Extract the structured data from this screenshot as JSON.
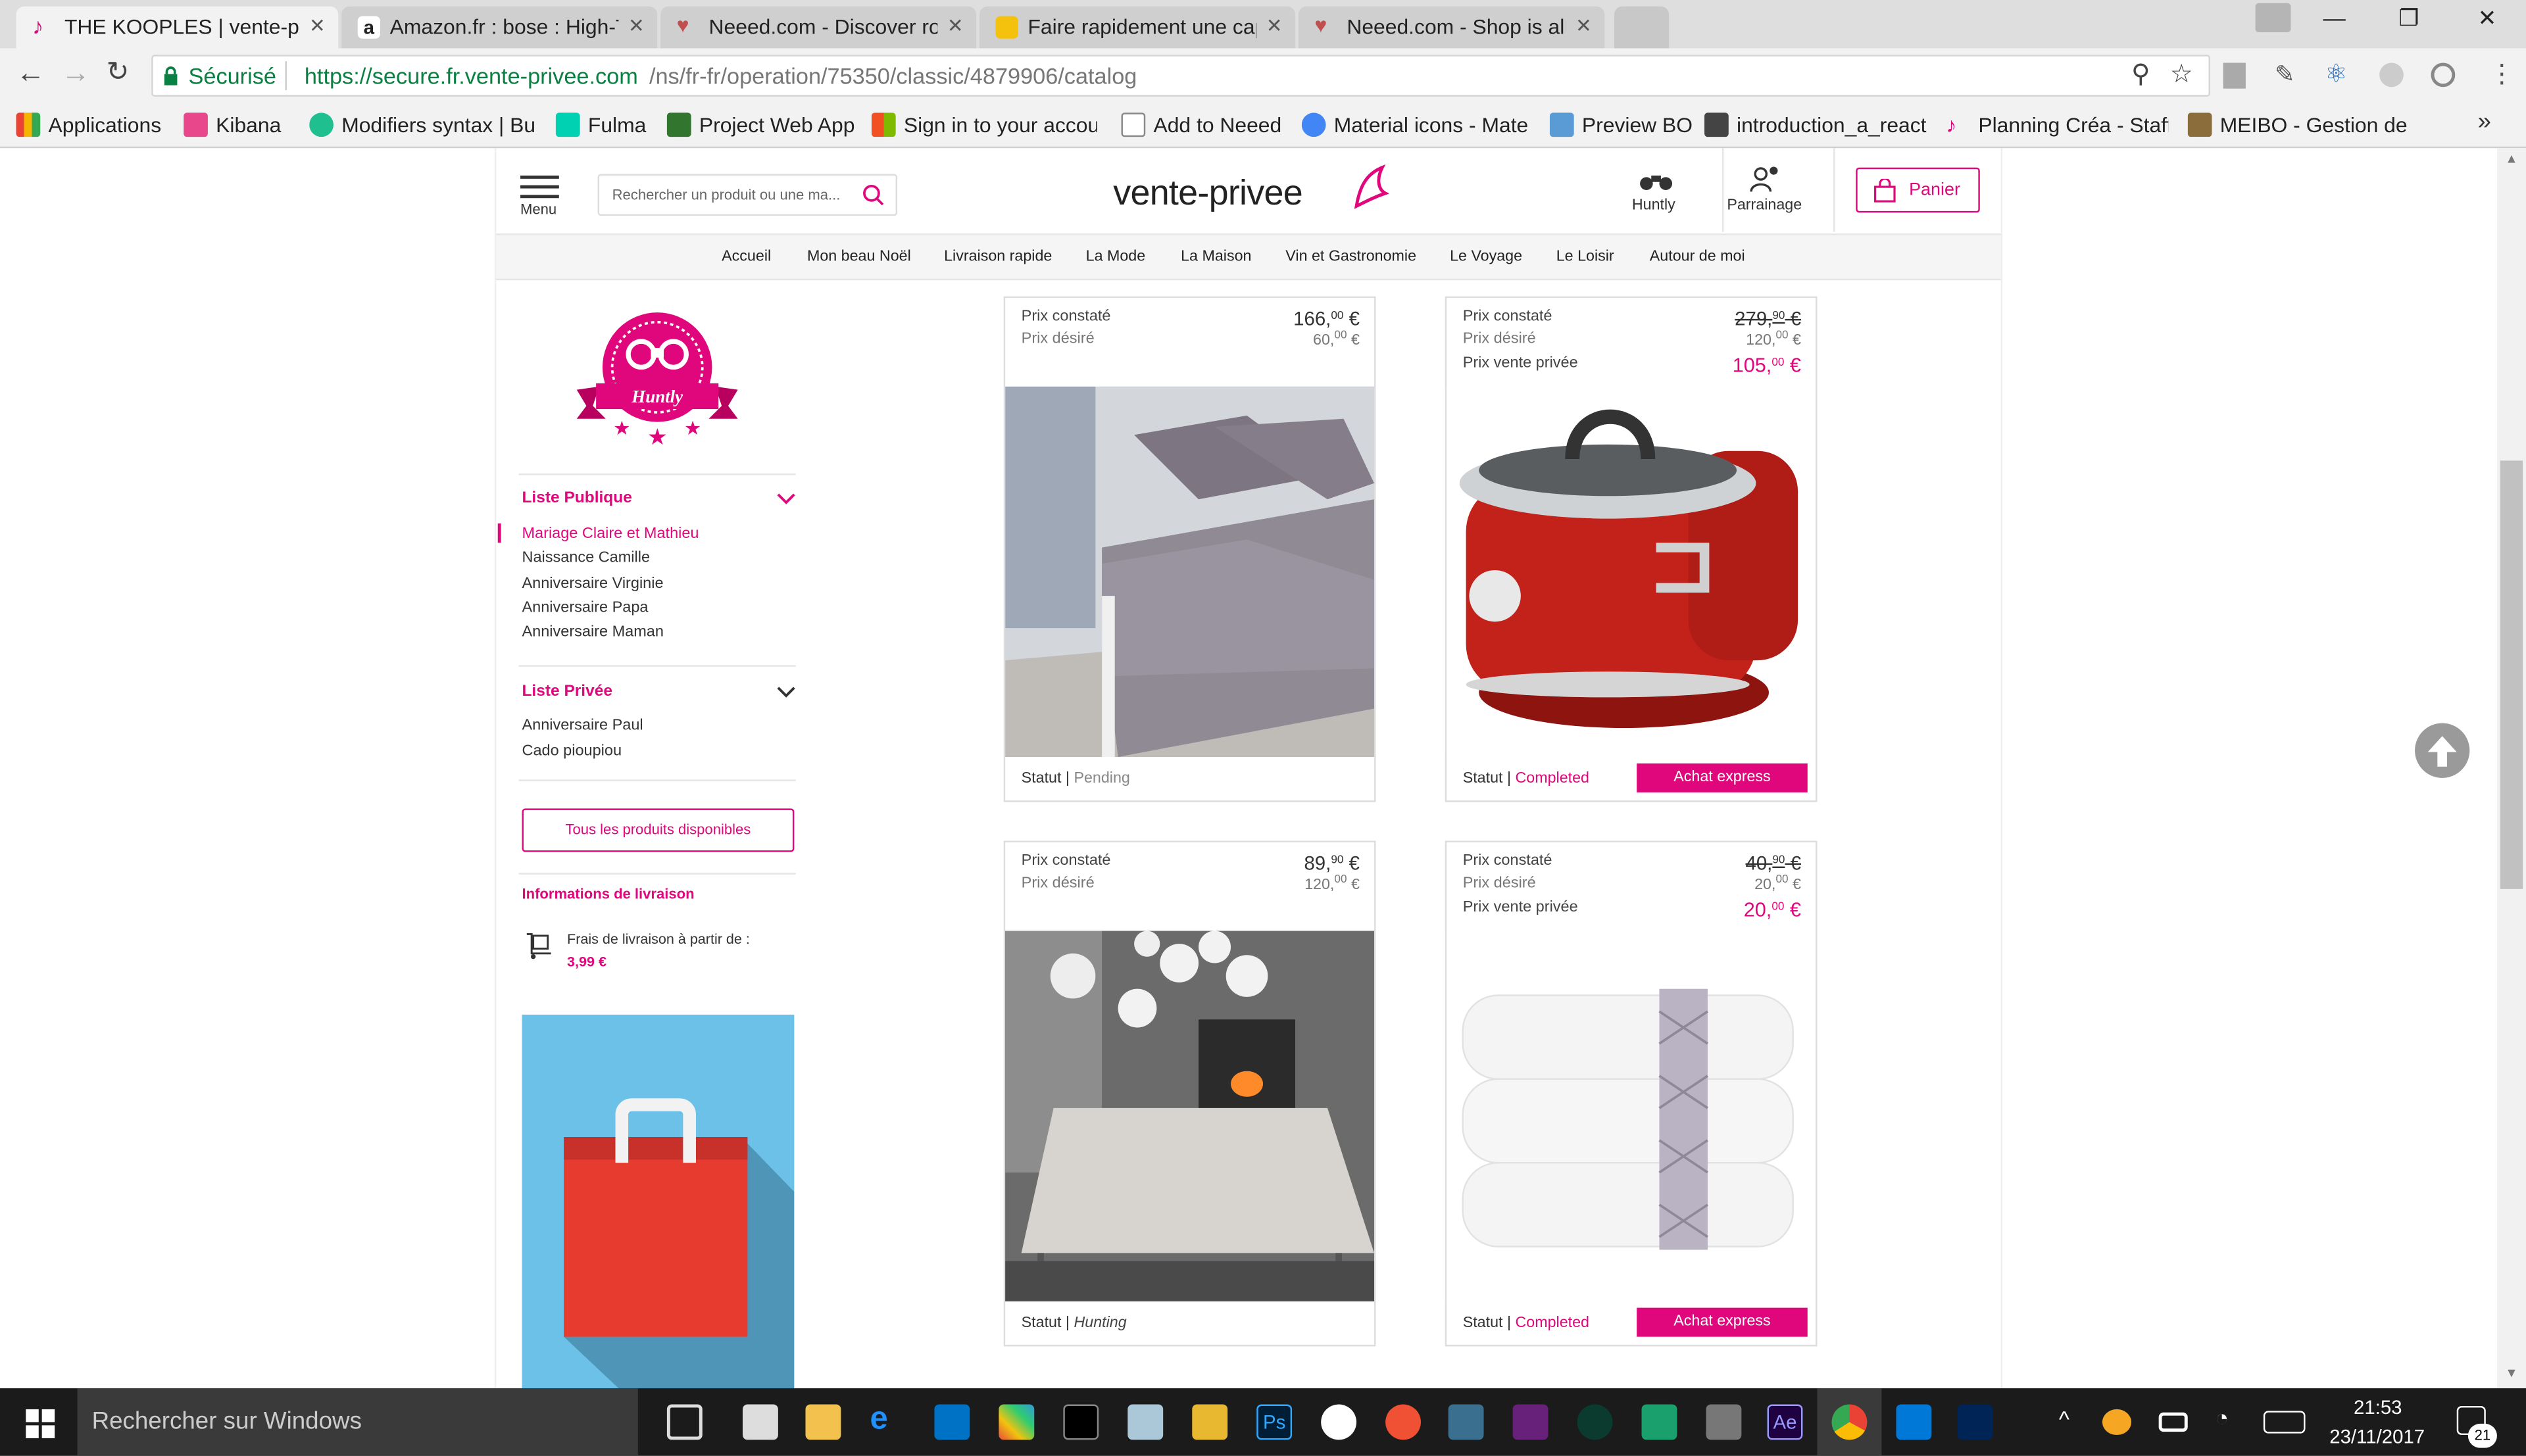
{
  "browser": {
    "tabs": [
      {
        "title": "THE KOOPLES | vente-pri",
        "color": "#e0077d"
      },
      {
        "title": "Amazon.fr : bose : High-T",
        "color": "#222222"
      },
      {
        "title": "Neeed.com - Discover ro",
        "color": "#c0504d"
      },
      {
        "title": "Faire rapidement une cap",
        "color": "#f4c20d"
      },
      {
        "title": "Neeed.com - Shop is all",
        "color": "#c0504d"
      }
    ],
    "secure_label": "Sécurisé",
    "url_host": "https://secure.fr.vente-privee.com",
    "url_path": "/ns/fr-fr/operation/75350/classic/4879906/catalog",
    "bookmarks": [
      {
        "label": "Applications",
        "color": "#f4b400"
      },
      {
        "label": "Kibana",
        "color": "#e8488b"
      },
      {
        "label": "Modifiers syntax | Bul",
        "color": "#1fbf8f"
      },
      {
        "label": "Fulma",
        "color": "#00d1b2"
      },
      {
        "label": "Project Web App",
        "color": "#31752f"
      },
      {
        "label": "Sign in to your accou",
        "color": "#f25022"
      },
      {
        "label": "Add to Neeed",
        "color": "#888888"
      },
      {
        "label": "Material icons - Mate",
        "color": "#4285f4"
      },
      {
        "label": "Preview BO",
        "color": "#5b9bd5"
      },
      {
        "label": "introduction_a_react",
        "color": "#444444"
      },
      {
        "label": "Planning Créa - Staffi",
        "color": "#e0077d"
      },
      {
        "label": "MEIBO - Gestion des",
        "color": "#8a6d3b"
      }
    ],
    "more_bookmarks": "»"
  },
  "site": {
    "menu_label": "Menu",
    "search_placeholder": "Rechercher un produit ou une ma...",
    "logo_text": "vente-privee",
    "huntly_label": "Huntly",
    "parrainage_label": "Parrainage",
    "panier_label": "Panier",
    "nav": [
      "Accueil",
      "Mon beau Noël",
      "Livraison rapide",
      "La Mode",
      "La Maison",
      "Vin et Gastronomie",
      "Le Voyage",
      "Le Loisir",
      "Autour de moi"
    ],
    "accent": "#e0077d"
  },
  "sidebar": {
    "badge_text": "Huntly",
    "public_title": "Liste Publique",
    "public_items": [
      "Mariage Claire et Mathieu",
      "Naissance Camille",
      "Anniversaire Virginie",
      "Anniversaire Papa",
      "Anniversaire Maman"
    ],
    "private_title": "Liste Privée",
    "private_items": [
      "Anniversaire Paul",
      "Cado pioupiou"
    ],
    "all_products_button": "Tous les produits disponibles",
    "delivery_title": "Informations de livraison",
    "delivery_text": "Frais de livraison à partir de :",
    "delivery_price": "3,99 €"
  },
  "products": [
    {
      "prix_constate_label": "Prix constaté",
      "prix_desire_label": "Prix désiré",
      "prix_vp_label": "",
      "constate_int": "166,",
      "constate_dec": "00",
      "desire_int": "60,",
      "desire_dec": "00",
      "vp_int": "",
      "vp_dec": "",
      "statut_label": "Statut",
      "statut_value": "Pending",
      "achat_label": "",
      "image": "bed-linen"
    },
    {
      "prix_constate_label": "Prix constaté",
      "prix_desire_label": "Prix désiré",
      "prix_vp_label": "Prix vente privée",
      "constate_int": "279,",
      "constate_dec": "90",
      "desire_int": "120,",
      "desire_dec": "00",
      "vp_int": "105,",
      "vp_dec": "00",
      "statut_label": "Statut",
      "statut_value": "Completed",
      "achat_label": "Achat express",
      "image": "multicooker"
    },
    {
      "prix_constate_label": "Prix constaté",
      "prix_desire_label": "Prix désiré",
      "prix_vp_label": "",
      "constate_int": "89,",
      "constate_dec": "90",
      "desire_int": "120,",
      "desire_dec": "00",
      "vp_int": "",
      "vp_dec": "",
      "statut_label": "Statut",
      "statut_value": "Hunting",
      "achat_label": "",
      "image": "tablecloth"
    },
    {
      "prix_constate_label": "Prix constaté",
      "prix_desire_label": "Prix désiré",
      "prix_vp_label": "Prix vente privée",
      "constate_int": "40,",
      "constate_dec": "90",
      "desire_int": "20,",
      "desire_dec": "00",
      "vp_int": "20,",
      "vp_dec": "00",
      "statut_label": "Statut",
      "statut_value": "Completed",
      "achat_label": "Achat express",
      "image": "towels"
    }
  ],
  "taskbar": {
    "search_text": "Rechercher sur Windows",
    "time": "21:53",
    "date": "23/11/2017",
    "notif_count": "21"
  }
}
